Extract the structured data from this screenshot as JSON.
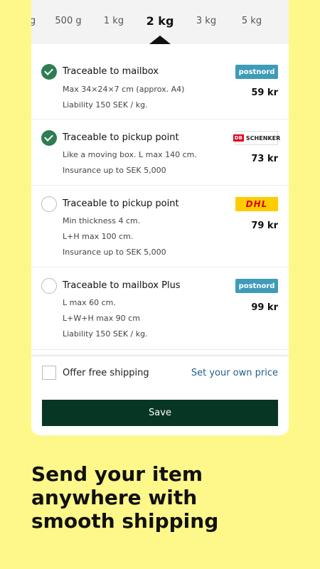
{
  "weights": {
    "items": [
      {
        "label": "g"
      },
      {
        "label": "500 g"
      },
      {
        "label": "1 kg"
      },
      {
        "label": "2 kg",
        "selected": true
      },
      {
        "label": "3 kg"
      },
      {
        "label": "5 kg"
      }
    ]
  },
  "options": [
    {
      "checked": true,
      "title": "Traceable to mailbox",
      "lines": [
        "Max 34×24×7 cm (approx. A4)",
        "Liability 150 SEK / kg."
      ],
      "carrier": "postnord",
      "carrier_label": "postnord",
      "price": "59 kr"
    },
    {
      "checked": true,
      "title": "Traceable to pickup point",
      "lines": [
        "Like a moving box. L max 140 cm.",
        "Insurance up to SEK 5,000"
      ],
      "carrier": "schenker",
      "carrier_label": "SCHENKER",
      "carrier_badge": "DB",
      "price": "73 kr"
    },
    {
      "checked": false,
      "title": "Traceable to pickup point",
      "lines": [
        "Min thickness 4 cm.",
        "L+H max 100 cm.",
        "Insurance up to SEK 5,000"
      ],
      "carrier": "dhl",
      "carrier_label": "DHL",
      "price": "79 kr"
    },
    {
      "checked": false,
      "title": "Traceable to mailbox Plus",
      "lines": [
        "L max 60 cm.",
        "L+W+H max 90 cm",
        "Liability 150 SEK / kg."
      ],
      "carrier": "postnord",
      "carrier_label": "postnord",
      "price": "99 kr"
    }
  ],
  "footer": {
    "free_shipping_label": "Offer free shipping",
    "own_price_label": "Set your own price",
    "save_label": "Save"
  },
  "promo": {
    "lines": [
      "Send your item",
      "anywhere with",
      "smooth shipping"
    ]
  },
  "colors": {
    "background": "#fef88a",
    "check_green": "#2e7d53",
    "save_button": "#073724",
    "link_blue": "#1f5f8f",
    "postnord": "#3f9bb8",
    "dhl_yellow": "#ffcc00",
    "dhl_red": "#d40511"
  }
}
